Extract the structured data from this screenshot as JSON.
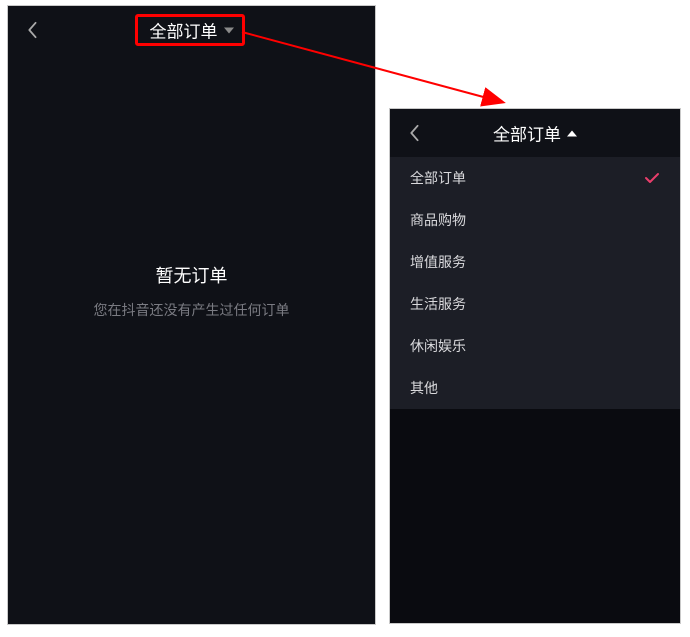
{
  "colors": {
    "accent": "#ff0033",
    "check": "#e83e6b"
  },
  "left": {
    "header": {
      "title": "全部订单"
    },
    "empty": {
      "title": "暂无订单",
      "subtitle": "您在抖音还没有产生过任何订单"
    }
  },
  "right": {
    "header": {
      "title": "全部订单"
    },
    "options": [
      {
        "label": "全部订单",
        "selected": true
      },
      {
        "label": "商品购物",
        "selected": false
      },
      {
        "label": "增值服务",
        "selected": false
      },
      {
        "label": "生活服务",
        "selected": false
      },
      {
        "label": "休闲娱乐",
        "selected": false
      },
      {
        "label": "其他",
        "selected": false
      }
    ]
  }
}
